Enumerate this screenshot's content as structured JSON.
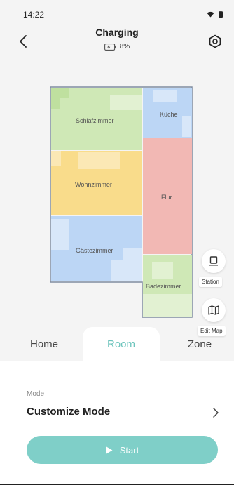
{
  "status": {
    "time": "14:22"
  },
  "header": {
    "title": "Charging",
    "battery_percent": "8%"
  },
  "map": {
    "rooms": [
      {
        "name": "Schlafzimmer",
        "color": "#cfe8b6"
      },
      {
        "name": "Küche",
        "color": "#bcd6f5"
      },
      {
        "name": "Wohnzimmer",
        "color": "#f9dc8b"
      },
      {
        "name": "Flur",
        "color": "#f2b8b4"
      },
      {
        "name": "Gästezimmer",
        "color": "#bcd6f5"
      },
      {
        "name": "Badezimmer",
        "color": "#cfe8b6"
      }
    ]
  },
  "side_buttons": {
    "station_label": "Station",
    "edit_map_label": "Edit Map"
  },
  "tabs": [
    {
      "label": "Home"
    },
    {
      "label": "Room"
    },
    {
      "label": "Zone"
    }
  ],
  "mode": {
    "caption": "Mode",
    "value": "Customize Mode"
  },
  "start": {
    "label": "Start"
  },
  "colors": {
    "accent": "#7fcfc8",
    "accent_text": "#6cc4bc"
  }
}
